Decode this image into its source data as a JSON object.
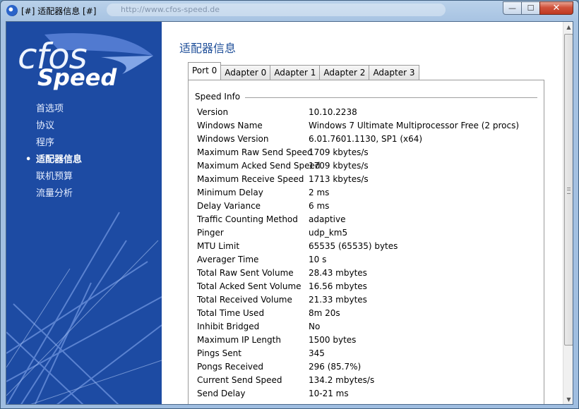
{
  "window": {
    "title": "[#] 适配器信息 [#]",
    "url_ghost": "http://www.cfos-speed.de",
    "buttons": {
      "minimize": "—",
      "maximize": "☐",
      "close": "✕"
    }
  },
  "logo": {
    "line1": "cfos",
    "line2": "Speed"
  },
  "sidebar": {
    "active_bullet": "•",
    "items": [
      {
        "label": "首选项"
      },
      {
        "label": "协议"
      },
      {
        "label": "程序"
      },
      {
        "label": "适配器信息"
      },
      {
        "label": "联机预算"
      },
      {
        "label": "流量分析"
      }
    ]
  },
  "main": {
    "title": "适配器信息",
    "tabs": [
      {
        "label": "Port 0"
      },
      {
        "label": "Adapter 0"
      },
      {
        "label": "Adapter 1"
      },
      {
        "label": "Adapter 2"
      },
      {
        "label": "Adapter 3"
      }
    ],
    "group_label": "Speed Info",
    "rows": [
      {
        "key": "Version",
        "value": "10.10.2238"
      },
      {
        "key": "Windows Name",
        "value": "Windows 7 Ultimate Multiprocessor Free (2 procs)"
      },
      {
        "key": "Windows Version",
        "value": "6.01.7601.1130, SP1 (x64)"
      },
      {
        "key": "Maximum Raw Send Speed",
        "value": "1709 kbytes/s"
      },
      {
        "key": "Maximum Acked Send Speed",
        "value": "1709 kbytes/s"
      },
      {
        "key": "Maximum Receive Speed",
        "value": "1713 kbytes/s"
      },
      {
        "key": "Minimum Delay",
        "value": "2 ms"
      },
      {
        "key": "Delay Variance",
        "value": "6 ms"
      },
      {
        "key": "Traffic Counting Method",
        "value": "adaptive"
      },
      {
        "key": "Pinger",
        "value": "udp_km5"
      },
      {
        "key": "MTU Limit",
        "value": "65535 (65535) bytes"
      },
      {
        "key": "Averager Time",
        "value": "10 s"
      },
      {
        "key": "Total Raw Sent Volume",
        "value": "28.43 mbytes"
      },
      {
        "key": "Total Acked Sent Volume",
        "value": "16.56 mbytes"
      },
      {
        "key": "Total Received Volume",
        "value": "21.33 mbytes"
      },
      {
        "key": "Total Time Used",
        "value": "8m 20s"
      },
      {
        "key": "Inhibit Bridged",
        "value": "No"
      },
      {
        "key": "Maximum IP Length",
        "value": "1500 bytes"
      },
      {
        "key": "Pings Sent",
        "value": "345"
      },
      {
        "key": "Pongs Received",
        "value": "296 (85.7%)"
      },
      {
        "key": "Current Send Speed",
        "value": "134.2 mbytes/s"
      },
      {
        "key": "Send Delay",
        "value": "10-21 ms"
      }
    ]
  },
  "scrollbar": {
    "up_glyph": "▲",
    "down_glyph": "▼"
  },
  "colors": {
    "sidebar_bg": "#1d4ba3",
    "title_blue": "#1f4f99",
    "close_red": "#c03a22"
  }
}
